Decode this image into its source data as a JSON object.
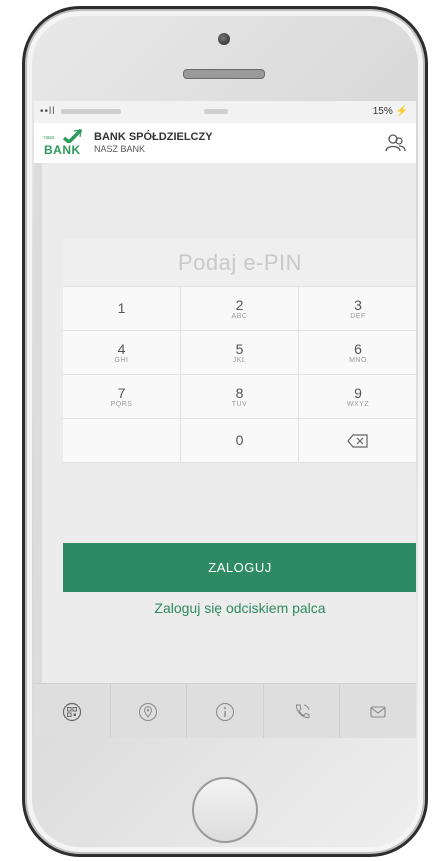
{
  "statusbar": {
    "signal": "••ll",
    "battery": "15%",
    "charging_glyph": "⚡"
  },
  "header": {
    "logo_small": "nasz",
    "logo_word": "BANK",
    "bank_name": "BANK SPÓŁDZIELCZY",
    "bank_sub": "NASZ BANK",
    "user_icon": "user-group-icon"
  },
  "pin": {
    "placeholder": "Podaj e-PIN"
  },
  "keypad": {
    "keys": [
      {
        "num": "1",
        "letters": ""
      },
      {
        "num": "2",
        "letters": "ABC"
      },
      {
        "num": "3",
        "letters": "DEF"
      },
      {
        "num": "4",
        "letters": "GHI"
      },
      {
        "num": "5",
        "letters": "JKL"
      },
      {
        "num": "6",
        "letters": "MNO"
      },
      {
        "num": "7",
        "letters": "PQRS"
      },
      {
        "num": "8",
        "letters": "TUV"
      },
      {
        "num": "9",
        "letters": "WXYZ"
      },
      {
        "num": "",
        "letters": ""
      },
      {
        "num": "0",
        "letters": ""
      },
      {
        "num": "",
        "letters": ""
      }
    ]
  },
  "actions": {
    "login_label": "ZALOGUJ",
    "fingerprint_label": "Zaloguj się odciskiem palca"
  },
  "tabbar": {
    "icons": [
      "qr-code-icon",
      "location-pin-icon",
      "info-icon",
      "phone-icon",
      "mail-icon"
    ]
  },
  "colors": {
    "brand_green": "#2e8a63",
    "logo_green": "#2e9a5a",
    "charging": "#e0312a"
  }
}
